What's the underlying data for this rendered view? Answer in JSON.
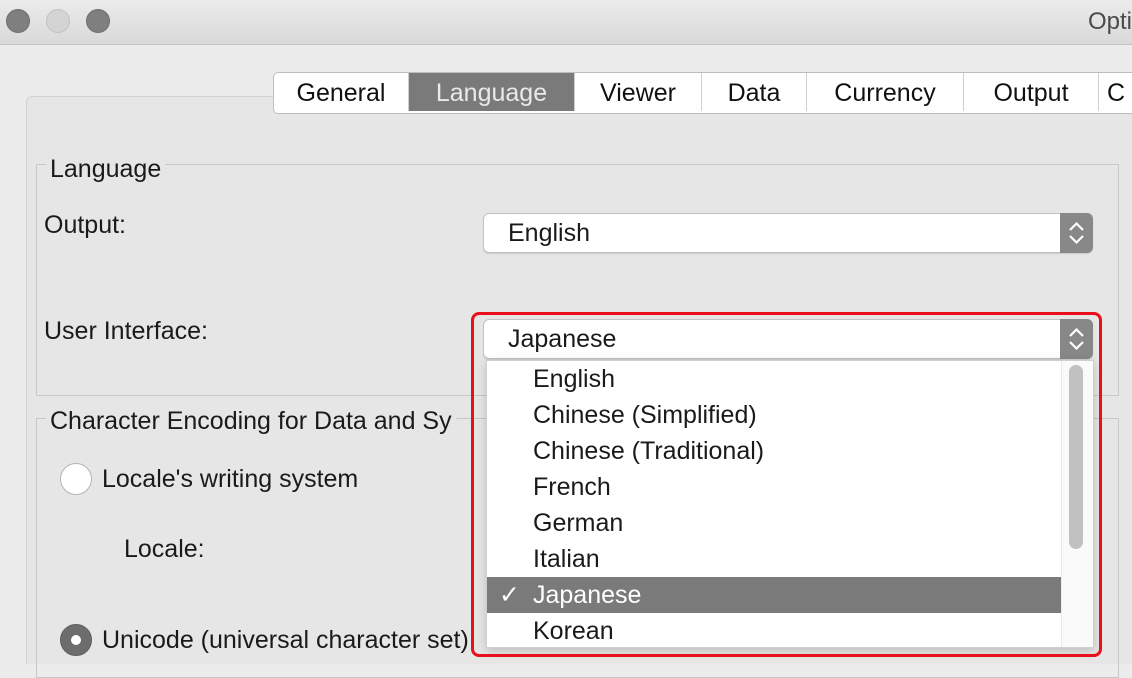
{
  "window": {
    "title": "Opti"
  },
  "tabs": [
    {
      "label": "General"
    },
    {
      "label": "Language"
    },
    {
      "label": "Viewer"
    },
    {
      "label": "Data"
    },
    {
      "label": "Currency"
    },
    {
      "label": "Output"
    },
    {
      "label": "C"
    }
  ],
  "active_tab": "Language",
  "language_group": {
    "title": "Language",
    "output_label": "Output:",
    "output_value": "English",
    "ui_label": "User Interface:",
    "ui_value": "Japanese"
  },
  "encoding_group": {
    "title": "Character Encoding for Data and Sy",
    "locale_radio_label": "Locale's writing system",
    "locale_label": "Locale:",
    "unicode_radio_label": "Unicode (universal character set)"
  },
  "dropdown": {
    "options": [
      {
        "label": "English"
      },
      {
        "label": "Chinese (Simplified)"
      },
      {
        "label": "Chinese (Traditional)"
      },
      {
        "label": "French"
      },
      {
        "label": "German"
      },
      {
        "label": "Italian"
      },
      {
        "label": "Japanese",
        "checkmark": "✓"
      },
      {
        "label": "Korean"
      }
    ]
  },
  "colors": {
    "highlight": "#e8101a",
    "selection": "#7a7a7a"
  }
}
